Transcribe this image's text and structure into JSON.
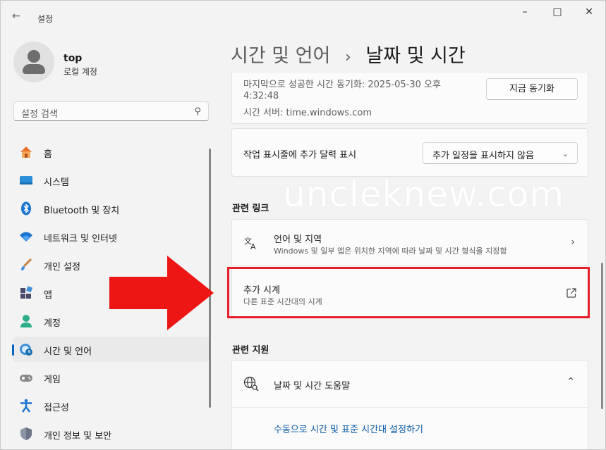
{
  "window": {
    "back_icon": "back-arrow-icon",
    "title": "설정",
    "controls": [
      "minimize-icon",
      "maximize-icon",
      "close-icon"
    ]
  },
  "profile": {
    "name": "top",
    "account_type": "로컬 계정"
  },
  "search": {
    "placeholder": "설정 검색"
  },
  "sidebar": {
    "items": [
      {
        "label": "홈",
        "icon": "home-icon"
      },
      {
        "label": "시스템",
        "icon": "system-icon"
      },
      {
        "label": "Bluetooth 및 장치",
        "icon": "bluetooth-icon"
      },
      {
        "label": "네트워크 및 인터넷",
        "icon": "wifi-icon"
      },
      {
        "label": "개인 설정",
        "icon": "brush-icon"
      },
      {
        "label": "앱",
        "icon": "apps-icon"
      },
      {
        "label": "계정",
        "icon": "account-icon"
      },
      {
        "label": "시간 및 언어",
        "icon": "time-language-icon",
        "active": true
      },
      {
        "label": "게임",
        "icon": "gamepad-icon"
      },
      {
        "label": "접근성",
        "icon": "accessibility-icon"
      },
      {
        "label": "개인 정보 및 보안",
        "icon": "shield-icon"
      }
    ]
  },
  "header": {
    "parent": "시간 및 언어",
    "separator": "›",
    "current": "날짜 및 시간"
  },
  "sync": {
    "line1": "마지막으로 성공한 시간 동기화: 2025-05-30 오후",
    "line2": "4:32:48",
    "line3": "시간 서버: time.windows.com",
    "button": "지금 동기화"
  },
  "calendar": {
    "label": "작업 표시줄에 추가 달력 표시",
    "dropdown_value": "추가 일정을 표시하지 않음"
  },
  "related_links": {
    "heading": "관련 링크",
    "language_region": {
      "title": "언어 및 지역",
      "subtitle": "Windows 및 일부 앱은 위치한 지역에 따라 날짜 및 시간 형식을 지정함"
    },
    "additional_clocks": {
      "title": "추가 시계",
      "subtitle": "다른 표준 시간대의 시계"
    }
  },
  "related_support": {
    "heading": "관련 지원",
    "help": {
      "title": "날짜 및 시간 도움말",
      "link": "수동으로 시간 및 표준 시간대 설정하기"
    }
  },
  "watermark": "uncleknew.com",
  "colors": {
    "accent": "#0067c0",
    "annotation_red": "#e5202a",
    "link": "#0a58a8"
  }
}
